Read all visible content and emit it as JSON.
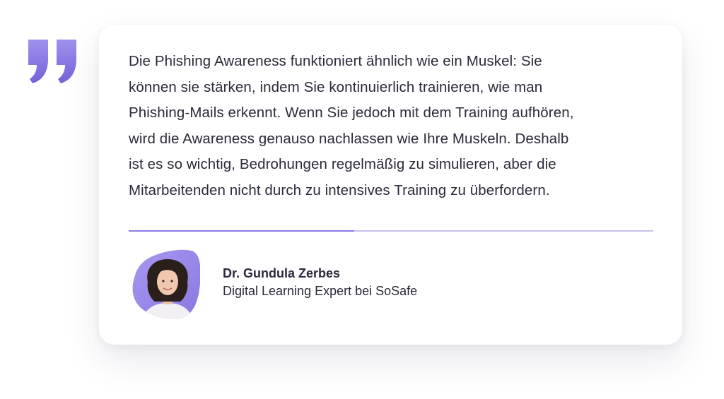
{
  "quote": {
    "lines": [
      "Die Phishing Awareness funktioniert ähnlich wie ein Muskel: Sie",
      "können sie stärken, indem Sie kontinuierlich trainieren, wie man",
      "Phishing-Mails erkennt. Wenn Sie jedoch mit dem Training aufhören,",
      "wird die Awareness genauso nachlassen wie Ihre Muskeln. Deshalb",
      "ist es so wichtig, Bedrohungen regelmäßig zu simulieren, aber die",
      "Mitarbeitenden nicht durch zu intensives Training zu überfordern."
    ]
  },
  "author": {
    "name": "Dr. Gundula Zerbes",
    "title": "Digital Learning Expert bei SoSafe"
  },
  "icons": {
    "quote": "closing-quote-icon",
    "avatar": "author-avatar"
  },
  "colors": {
    "accent": "#8a7ae6",
    "accent_light": "#c6c0ee",
    "text": "#2a2a3a"
  }
}
